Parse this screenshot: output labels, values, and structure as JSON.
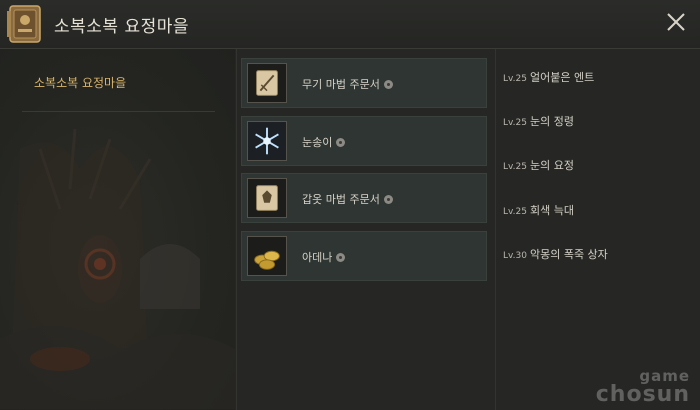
{
  "window": {
    "title": "소복소복 요정마을",
    "icon": "spellbook-icon",
    "close_icon": "close-icon"
  },
  "locations": [
    {
      "label": "소복소복 요정마을",
      "selected": true
    }
  ],
  "rewards": [
    {
      "name": "무기 마법 주문서",
      "icon": "weapon-scroll-icon"
    },
    {
      "name": "눈송이",
      "icon": "snowflake-icon"
    },
    {
      "name": "갑옷 마법 주문서",
      "icon": "armor-scroll-icon"
    },
    {
      "name": "아데나",
      "icon": "adena-coins-icon"
    }
  ],
  "monsters": [
    {
      "level": "Lv.25",
      "name": "얼어붙은 엔트"
    },
    {
      "level": "Lv.25",
      "name": "눈의 정령"
    },
    {
      "level": "Lv.25",
      "name": "눈의 요정"
    },
    {
      "level": "Lv.25",
      "name": "회색 늑대"
    },
    {
      "level": "Lv.30",
      "name": "악몽의 폭죽 상자"
    }
  ],
  "watermark": {
    "line1": "game",
    "line2": "chosun"
  }
}
